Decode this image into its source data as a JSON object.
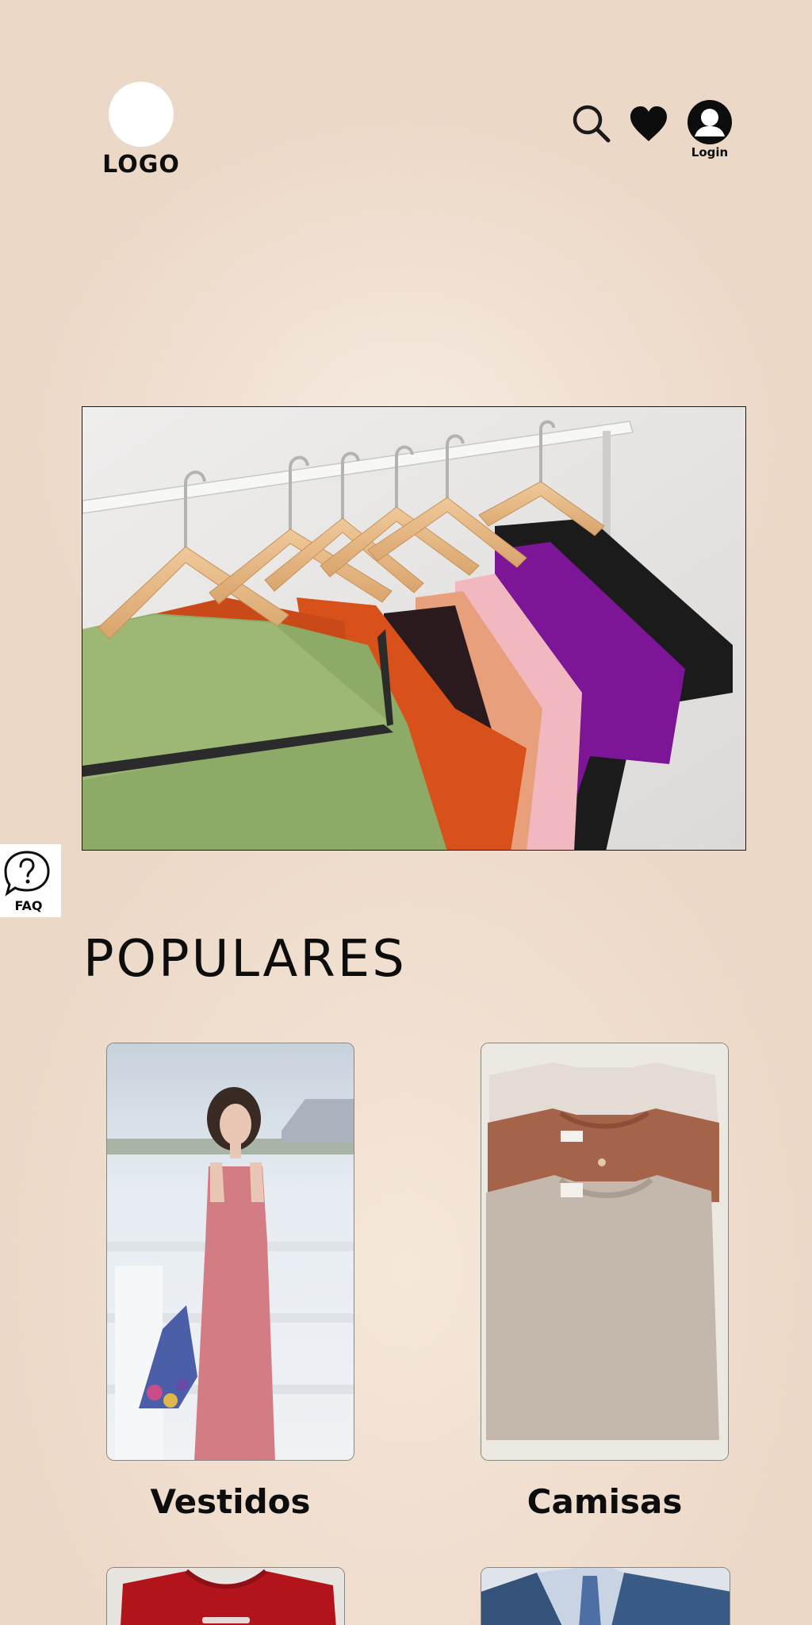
{
  "header": {
    "logo_text": "LOGO",
    "login_label": "Login",
    "icons": [
      "search-icon",
      "heart-icon",
      "user-icon"
    ]
  },
  "hero": {
    "image": "clothes-on-hangers-photo"
  },
  "faq": {
    "label": "FAQ",
    "icon": "question-bubble-icon"
  },
  "popular": {
    "title": "POPULARES",
    "items": [
      {
        "label": "Vestidos",
        "image": "woman-pink-dress-photo"
      },
      {
        "label": "Camisas",
        "image": "folded-shirts-photo"
      },
      {
        "label": "",
        "image": "red-tshirt-photo"
      },
      {
        "label": "",
        "image": "blue-suit-photo"
      }
    ]
  },
  "colors": {
    "background": "#ecd8c7",
    "text": "#0d0d0d",
    "white": "#ffffff"
  }
}
